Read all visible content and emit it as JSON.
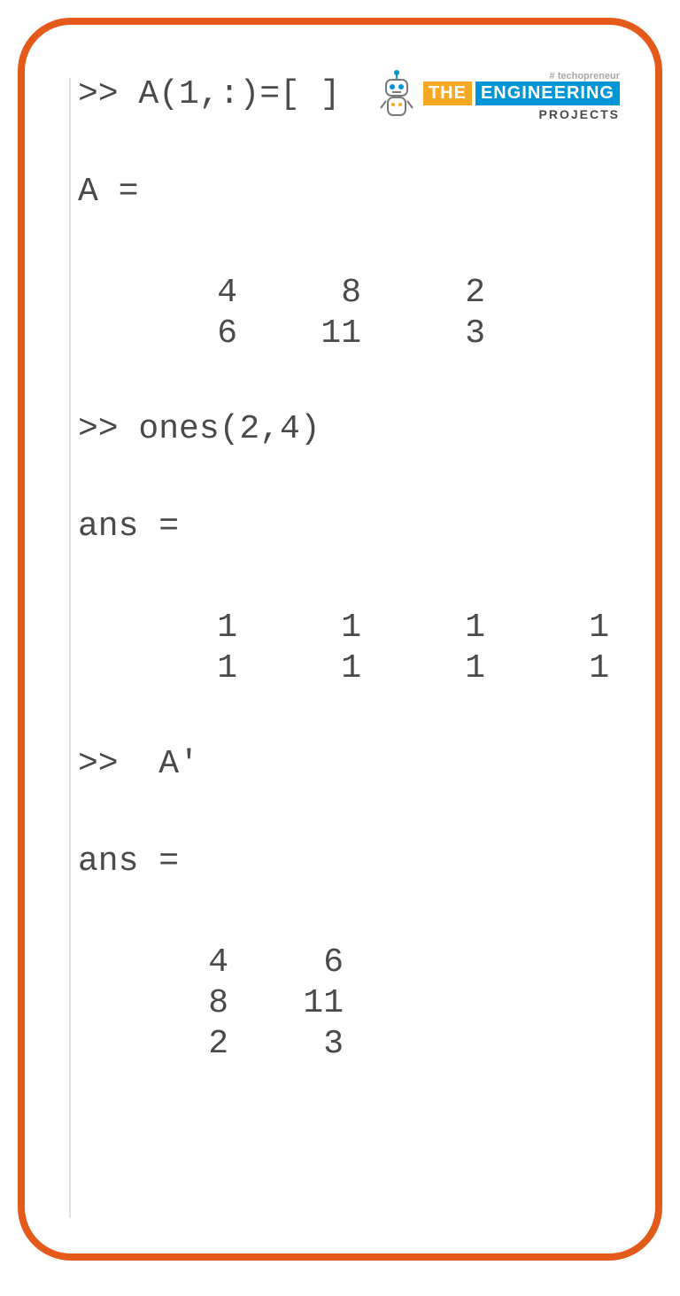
{
  "watermark": {
    "hash": "# techopreneur",
    "the": "THE",
    "eng": "ENGINEERING",
    "proj": "PROJECTS",
    "robot_icon_name": "robot-icon"
  },
  "console": {
    "cmd1": ">> A(1,:)=[ ]",
    "var1_label": "A =",
    "matrix_A": {
      "rows": [
        [
          "4",
          "8",
          "2"
        ],
        [
          "6",
          "11",
          "3"
        ]
      ]
    },
    "cmd2": ">> ones(2,4)",
    "ans1_label": "ans =",
    "matrix_ones": {
      "rows": [
        [
          "1",
          "1",
          "1",
          "1"
        ],
        [
          "1",
          "1",
          "1",
          "1"
        ]
      ]
    },
    "cmd3": ">>  A'",
    "ans2_label": "ans =",
    "matrix_At": {
      "rows": [
        [
          "4",
          "6"
        ],
        [
          "8",
          "11"
        ],
        [
          "2",
          "3"
        ]
      ]
    }
  }
}
